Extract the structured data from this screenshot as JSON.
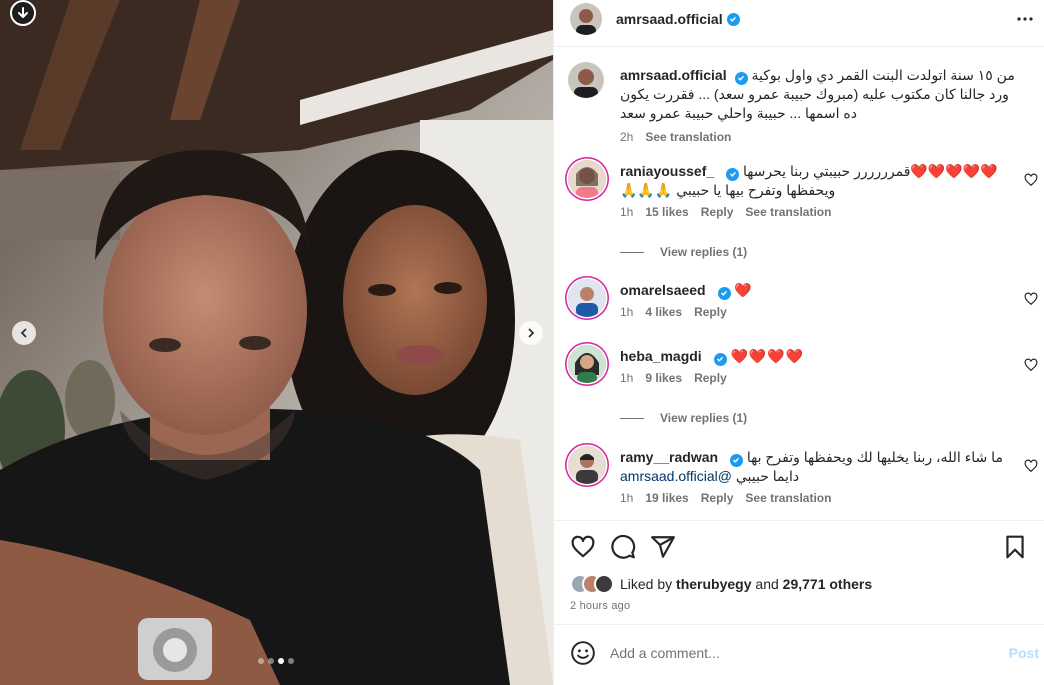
{
  "media": {
    "download_icon": "arrow-down-circle-icon",
    "prev_icon": "chevron-left-icon",
    "next_icon": "chevron-right-icon",
    "carousel": {
      "count": 4,
      "active": 3
    }
  },
  "post": {
    "author": "amrsaad.official",
    "caption": "من ١٥ سنة اتولدت البنت القمر دي واول بوكية ورد جالنا كان مكتوب عليه (مبروك حبيبة عمرو سعد) ... فقررت يكون ده اسمها ... حبيبة واحلي حبيبة عمرو سعد",
    "time": "2h",
    "see_translation": "See translation"
  },
  "comments": [
    {
      "user": "raniayoussef_",
      "text": "قمرررررر حبيبتي ربنا يحرسها",
      "hearts": "❤️❤️❤️❤️❤️",
      "line2": "ويحفظها وتفرح بيها يا حبيبي",
      "hands": "🙏🙏🙏",
      "time": "1h",
      "likes": "15 likes",
      "reply": "Reply",
      "see_translation": "See translation",
      "view_replies": "View replies (1)"
    },
    {
      "user": "omarelsaeed",
      "hearts": "❤️",
      "time": "1h",
      "likes": "4 likes",
      "reply": "Reply"
    },
    {
      "user": "heba_magdi",
      "hearts": "❤️❤️❤️❤️",
      "time": "1h",
      "likes": "9 likes",
      "reply": "Reply",
      "view_replies": "View replies (1)"
    },
    {
      "user": "ramy__radwan",
      "text": "ما شاء الله، ربنا يخليها لك ويحفظها وتفرح بها",
      "mention": "amrsaad.official@",
      "line2": "دايما حبيبي",
      "time": "1h",
      "likes": "19 likes",
      "reply": "Reply",
      "see_translation": "See translation"
    }
  ],
  "actions": {
    "like_icon": "heart-icon",
    "comment_icon": "comment-icon",
    "share_icon": "paper-plane-icon",
    "save_icon": "bookmark-icon"
  },
  "likes": {
    "prefix": "Liked by",
    "user": "therubyegy",
    "connector": "and",
    "others": "29,771 others"
  },
  "posted": "2 hours ago",
  "composer": {
    "placeholder": "Add a comment...",
    "post_label": "Post",
    "emoji_icon": "smiley-icon"
  },
  "colors": {
    "verified": "#1d9bf0",
    "heart": "#ed1c24",
    "post_disabled": "#b2dffc",
    "story_ring": "#d6249f"
  }
}
